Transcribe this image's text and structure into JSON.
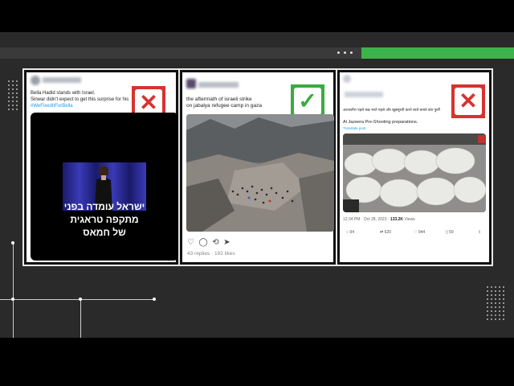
{
  "cards": [
    {
      "verdict": "false",
      "badge_icon": "✕",
      "text_line1": "Bella Hadid stands with Israel.",
      "text_line2": "Sinwar didn't expect to get this surprise for his 61",
      "hashtag": "#WeFixedItForBella",
      "video_caption_line1": "ישראל עומדה בפני",
      "video_caption_line2": "מתקפה טראגית",
      "video_caption_line3": "של חמאס"
    },
    {
      "verdict": "true",
      "badge_icon": "✓",
      "text_line1": "the aftermath of israeli strike",
      "text_line2": "on jabalya refugee camp in gaza",
      "replies": "43 replies",
      "dot": "·",
      "likes": "192 likes"
    },
    {
      "verdict": "false",
      "badge_icon": "✕",
      "text_line1": "अल्जजीरा पहले कब्र भरते पहले और खूबसूरती करते लाशें बनाते क्या फुर्ती",
      "text_line2": "Al Jazeera Pre-Shooting preparations.",
      "translate": "Translate post",
      "timestamp": "12:34 PM · Oct 28, 2023 · ",
      "views_count": "133.2K",
      "views_label": " Views",
      "stat_replies": "94",
      "stat_reposts": "620",
      "stat_likes": "944",
      "stat_bookmarks": "59"
    }
  ]
}
